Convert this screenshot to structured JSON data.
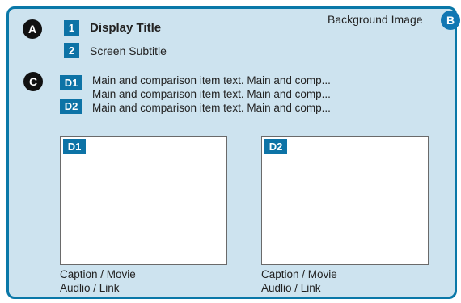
{
  "markers": {
    "a": "A",
    "b": "B",
    "c": "C"
  },
  "background_label": "Background Image",
  "header": {
    "title_num": "1",
    "title": "Display Title",
    "subtitle_num": "2",
    "subtitle": "Screen Subtitle"
  },
  "items": [
    {
      "tag": "D1",
      "lines": [
        "Main and comparison item text. Main and comp...",
        "Main and comparison item text. Main and comp..."
      ]
    },
    {
      "tag": "D2",
      "lines": [
        "Main and comparison item text. Main and comp..."
      ]
    }
  ],
  "media": [
    {
      "tag": "D1",
      "caption_line1": "Caption / Movie",
      "caption_line2": "Audlio / Link"
    },
    {
      "tag": "D2",
      "caption_line1": "Caption / Movie",
      "caption_line2": "Audlio / Link"
    }
  ],
  "colors": {
    "frame": "#0a78a8",
    "panel_bg": "#cde3ef",
    "tag_bg": "#0d73a6"
  }
}
